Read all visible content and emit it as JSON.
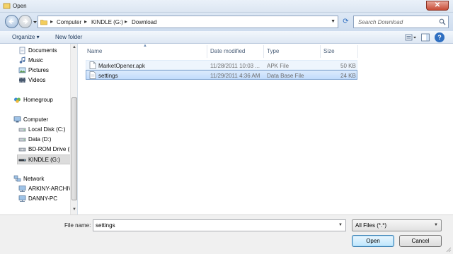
{
  "window": {
    "title": "Open",
    "close_glyph": "✕"
  },
  "nav": {
    "breadcrumbs": [
      "Computer",
      "KINDLE (G:)",
      "Download"
    ],
    "separator": "▸",
    "search_placeholder": "Search Download"
  },
  "toolbar": {
    "organize": "Organize ▾",
    "new_folder": "New folder",
    "help": "?"
  },
  "sidebar": {
    "items": [
      {
        "label": "Documents",
        "icon": "documents-icon"
      },
      {
        "label": "Music",
        "icon": "music-icon"
      },
      {
        "label": "Pictures",
        "icon": "pictures-icon"
      },
      {
        "label": "Videos",
        "icon": "videos-icon"
      },
      {
        "label": "Homegroup",
        "icon": "homegroup-icon"
      },
      {
        "label": "Computer",
        "icon": "computer-icon"
      },
      {
        "label": "Local Disk (C:)",
        "icon": "drive-icon"
      },
      {
        "label": "Data (D:)",
        "icon": "drive-icon"
      },
      {
        "label": "BD-ROM Drive (F",
        "icon": "optical-drive-icon"
      },
      {
        "label": "KINDLE (G:)",
        "icon": "usb-drive-icon",
        "selected": true
      },
      {
        "label": "Network",
        "icon": "network-icon"
      },
      {
        "label": "ARKINY-ARCHIV",
        "icon": "network-computer-icon"
      },
      {
        "label": "DANNY-PC",
        "icon": "network-computer-icon"
      }
    ]
  },
  "files": {
    "columns": {
      "name": "Name",
      "date": "Date modified",
      "type": "Type",
      "size": "Size"
    },
    "rows": [
      {
        "name": "MarketOpener.apk",
        "date": "11/28/2011 10:03 ...",
        "type": "APK File",
        "size": "50 KB"
      },
      {
        "name": "settings",
        "date": "11/29/2011 4:36 AM",
        "type": "Data Base File",
        "size": "24 KB",
        "selected": true
      }
    ]
  },
  "footer": {
    "file_name_label": "File name:",
    "file_name_value": "settings",
    "filter_value": "All Files (*.*)",
    "open_label": "Open",
    "cancel_label": "Cancel"
  },
  "colors": {
    "accent": "#2f6fc1",
    "selection": "#c1dbfc",
    "chrome": "#dce6f2"
  }
}
